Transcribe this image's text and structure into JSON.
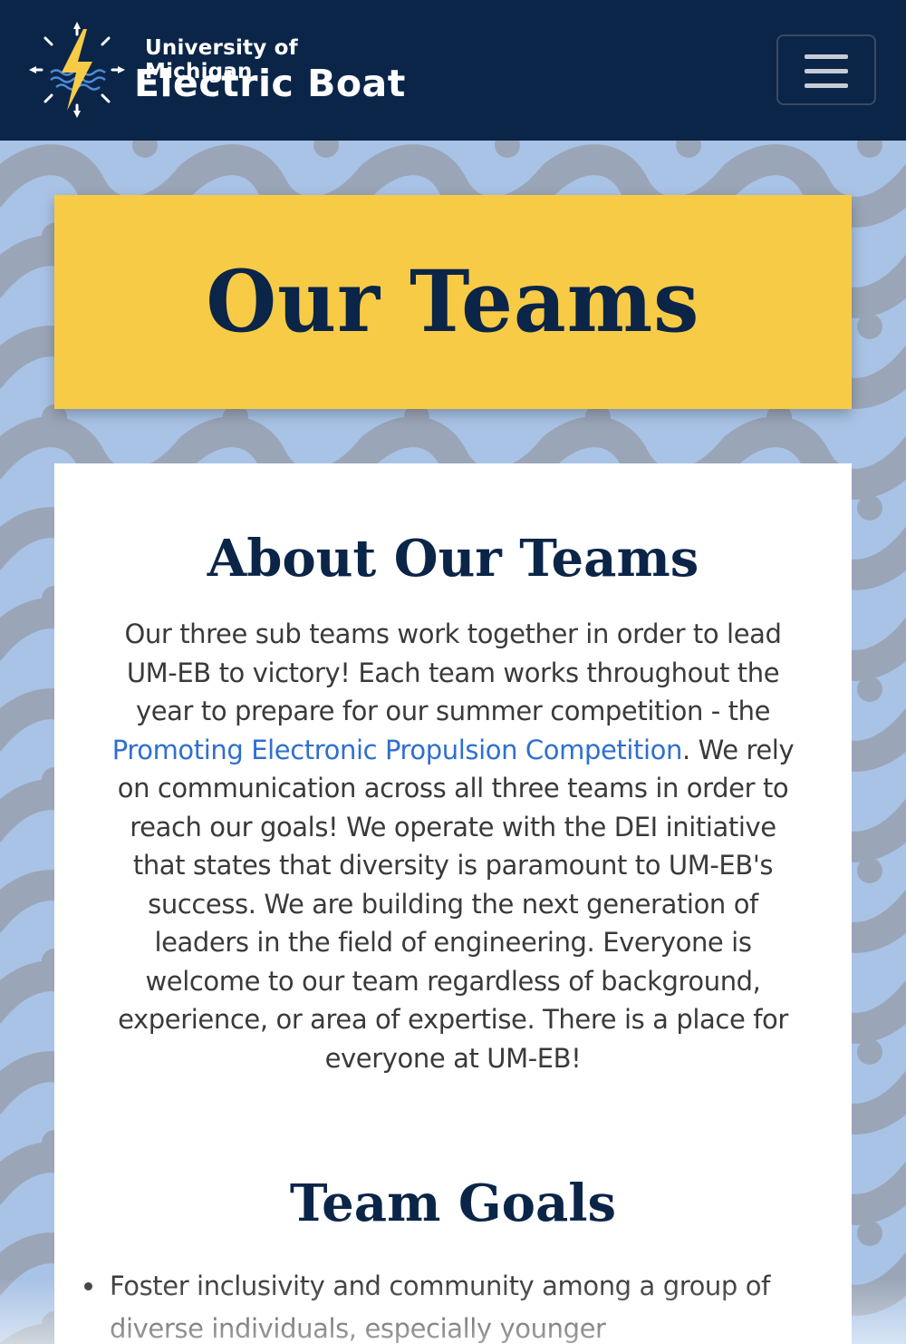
{
  "colors": {
    "navbar": "#0b2548",
    "hero_bg": "#f8cb46",
    "heading": "#0b2548",
    "link": "#2f6fcf",
    "pattern_light": "#a9c3e6",
    "pattern_dark": "#9aa6b8"
  },
  "header": {
    "brand_small": "University of Michigan",
    "brand_big": "Electric Boat",
    "logo_icon": "lightning-bolt-compass-icon",
    "menu_icon": "hamburger-menu-icon"
  },
  "hero": {
    "title": "Our Teams"
  },
  "about": {
    "title": "About Our Teams",
    "text_before_link": "Our three sub teams work together in order to lead UM-EB to victory! Each team works throughout the year to prepare for our summer competition - the ",
    "link_text": "Promoting Electronic Propulsion Competition",
    "text_after_link": ". We rely on communication across all three teams in order to reach our goals! We operate with the DEI initiative that states that diversity is paramount to UM-EB's success. We are building the next generation of leaders in the field of engineering. Everyone is welcome to our team regardless of background, experience, or area of expertise. There is a place for everyone at UM-EB!"
  },
  "goals": {
    "title": "Team Goals",
    "items": [
      "Foster inclusivity and community among a group of diverse individuals, especially younger"
    ]
  }
}
